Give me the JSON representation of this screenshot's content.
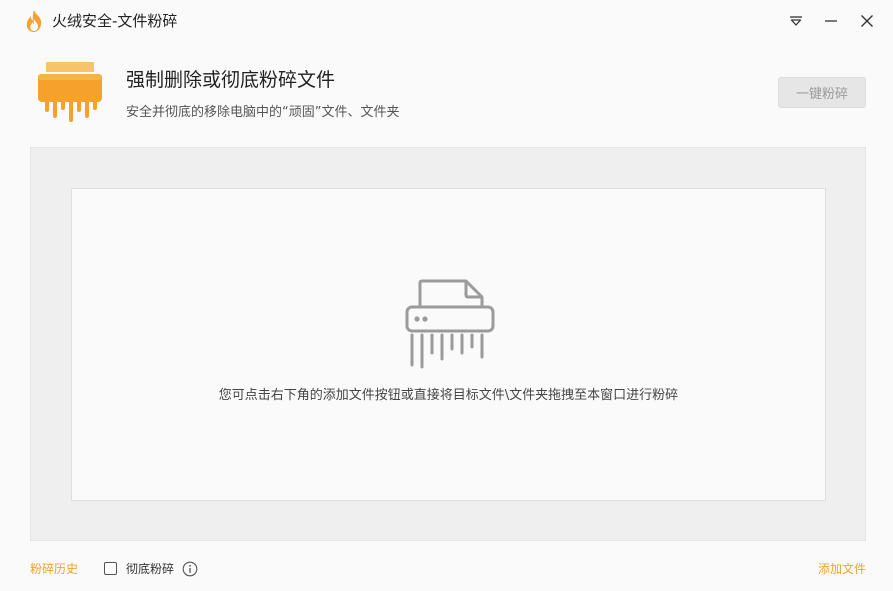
{
  "window": {
    "title": "火绒安全-文件粉碎"
  },
  "header": {
    "title": "强制删除或彻底粉碎文件",
    "subtitle": "安全并彻底的移除电脑中的“顽固”文件、文件夹",
    "shred_button": "一键粉碎"
  },
  "drop_area": {
    "hint": "您可点击右下角的添加文件按钮或直接将目标文件\\文件夹拖拽至本窗口进行粉碎"
  },
  "footer": {
    "history_link": "粉碎历史",
    "thorough_label": "彻底粉碎",
    "thorough_checked": false,
    "add_file_link": "添加文件"
  },
  "colors": {
    "accent": "#f5a12a",
    "icon_gray": "#9b9b9b"
  }
}
